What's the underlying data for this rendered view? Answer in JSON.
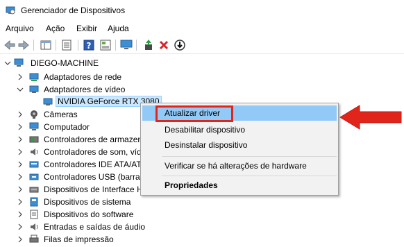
{
  "window": {
    "title": "Gerenciador de Dispositivos",
    "icon": "device-manager-icon"
  },
  "menu": [
    "Arquivo",
    "Ação",
    "Exibir",
    "Ajuda"
  ],
  "toolbar": {
    "buttons": [
      "back-icon",
      "forward-icon",
      "properties-pane-icon",
      "list-icon",
      "help-icon",
      "properties-icon",
      "monitor-scan-icon",
      "update-driver-icon",
      "uninstall-icon",
      "download-icon"
    ]
  },
  "tree": {
    "root": "DIEGO-MACHINE",
    "items": [
      {
        "label": "Adaptadores de rede",
        "icon": "network-adapter-icon",
        "expanded": false
      },
      {
        "label": "Adaptadores de vídeo",
        "icon": "display-adapter-icon",
        "expanded": true
      },
      {
        "label": "NVIDIA GeForce RTX 3080",
        "icon": "gpu-icon",
        "child": true,
        "selected": true
      },
      {
        "label": "Câmeras",
        "icon": "camera-icon",
        "expanded": false
      },
      {
        "label": "Computador",
        "icon": "computer-icon",
        "expanded": false
      },
      {
        "label": "Controladores de armazen",
        "icon": "storage-controller-icon",
        "expanded": false
      },
      {
        "label": "Controladores de som, víd",
        "icon": "sound-icon",
        "expanded": false
      },
      {
        "label": "Controladores IDE ATA/ATA",
        "icon": "ide-icon",
        "expanded": false
      },
      {
        "label": "Controladores USB (barran",
        "icon": "usb-icon",
        "expanded": false
      },
      {
        "label": "Dispositivos de Interface H",
        "icon": "hid-icon",
        "expanded": false
      },
      {
        "label": "Dispositivos de sistema",
        "icon": "system-devices-icon",
        "expanded": false
      },
      {
        "label": "Dispositivos do software",
        "icon": "software-devices-icon",
        "expanded": false
      },
      {
        "label": "Entradas e saídas de áudio",
        "icon": "audio-io-icon",
        "expanded": false
      },
      {
        "label": "Filas de impressão",
        "icon": "print-queue-icon",
        "expanded": false
      }
    ]
  },
  "context_menu": {
    "items": [
      {
        "label": "Atualizar driver",
        "hover": true
      },
      {
        "label": "Desabilitar dispositivo"
      },
      {
        "label": "Desinstalar dispositivo"
      },
      {
        "label": "Verificar se há alterações de hardware"
      },
      {
        "label": "Propriedades",
        "bold": true
      }
    ]
  },
  "colors": {
    "highlight_red": "#e1251b",
    "hover_blue": "#91c9f7",
    "selection_blue": "#cce8ff"
  }
}
